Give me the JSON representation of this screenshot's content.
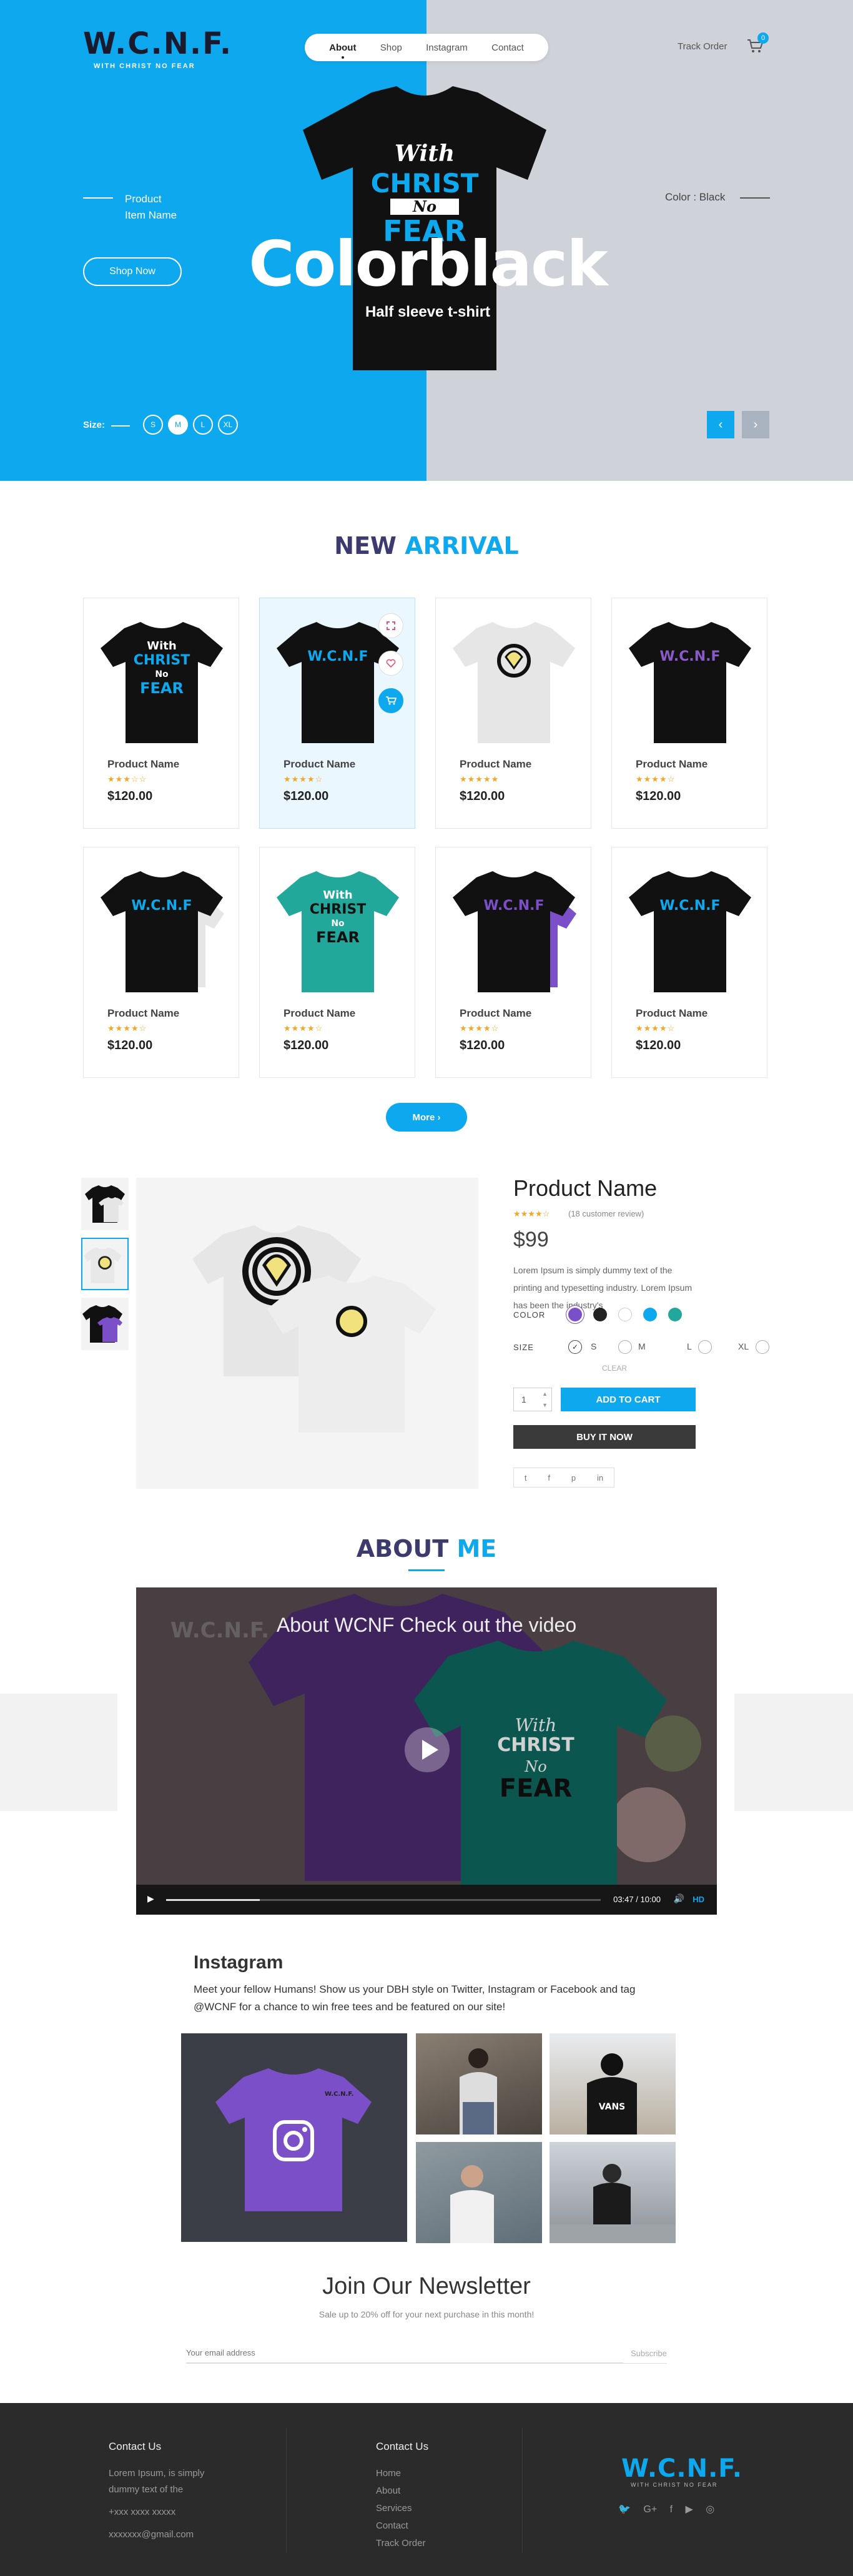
{
  "header": {
    "logo": "W.C.N.F.",
    "logo_tagline": "WITH CHRIST NO FEAR",
    "nav": [
      "About",
      "Shop",
      "Instagram",
      "Contact"
    ],
    "track_order": "Track Order",
    "cart_count": "0"
  },
  "hero": {
    "product_label_1": "Product",
    "product_label_2": "Item Name",
    "color_label": "Color : Black",
    "shop_now": "Shop Now",
    "title": "Colorblack",
    "subtitle": "Half sleeve t-shirt",
    "size_label": "Size:",
    "sizes": [
      "S",
      "M",
      "L",
      "XL"
    ],
    "selected_size": "M",
    "shirt_text": [
      "With",
      "CHRIST",
      "No",
      "FEAR"
    ],
    "colors": {
      "left_bg": "#0ea8ee",
      "right_bg": "#cfd2d8"
    }
  },
  "new_arrival": {
    "title_a": "NEW",
    "title_b": "ARRIVAL",
    "products": [
      {
        "name": "Product Name",
        "stars": "★★★☆☆",
        "price": "$120.00"
      },
      {
        "name": "Product Name",
        "stars": "★★★★☆",
        "price": "$120.00"
      },
      {
        "name": "Product Name",
        "stars": "★★★★★",
        "price": "$120.00"
      },
      {
        "name": "Product Name",
        "stars": "★★★★☆",
        "price": "$120.00"
      },
      {
        "name": "Product Name",
        "stars": "★★★★☆",
        "price": "$120.00"
      },
      {
        "name": "Product Name",
        "stars": "★★★★☆",
        "price": "$120.00"
      },
      {
        "name": "Product Name",
        "stars": "★★★★☆",
        "price": "$120.00"
      },
      {
        "name": "Product Name",
        "stars": "★★★★☆",
        "price": "$120.00"
      }
    ],
    "more": "More"
  },
  "detail": {
    "title": "Product Name",
    "stars": "★★★★☆",
    "reviews": "(18 customer review)",
    "price": "$99",
    "description": "Lorem Ipsum is simply dummy text of the printing and typesetting industry. Lorem Ipsum has been the industry's",
    "color_label": "COLOR",
    "size_label": "SIZE",
    "sizes": [
      "S",
      "M",
      "L",
      "XL"
    ],
    "clear": "CLEAR",
    "qty": "1",
    "add_to_cart": "ADD TO CART",
    "buy_now": "BUY IT NOW",
    "swatches": [
      "#7b4fc7",
      "#222222",
      "#ffffff",
      "#0ea8ee",
      "#21a89b"
    ],
    "social": [
      "t",
      "f",
      "p",
      "in"
    ]
  },
  "about": {
    "title_a": "ABOUT",
    "title_b": "ME",
    "video_title": "About WCNF Check out the video",
    "video_watermark": "W.C.N.F.",
    "video_time": "03:47 / 10:00",
    "video_hd": "HD"
  },
  "instagram": {
    "title": "Instagram",
    "text": "Meet your fellow Humans! Show us your DBH style on Twitter, Instagram or Facebook and tag @WCNF for a chance to win free tees and be featured on our site!"
  },
  "newsletter": {
    "title": "Join Our Newsletter",
    "subtitle": "Sale up to 20% off for your next purchase in this month!",
    "placeholder": "Your email address",
    "subscribe": "Subscribe"
  },
  "footer": {
    "contact_title": "Contact Us",
    "contact_text_1": "Lorem Ipsum, is simply",
    "contact_text_2": "dummy text of the",
    "phone": "+xxx xxxx xxxxx",
    "email": "xxxxxxx@gmail.com",
    "links_title": "Contact Us",
    "links": [
      "Home",
      "About",
      "Services",
      "Contact",
      "Track Order"
    ],
    "logo": "W.C.N.F.",
    "logo_tagline": "WITH CHRIST NO FEAR"
  }
}
